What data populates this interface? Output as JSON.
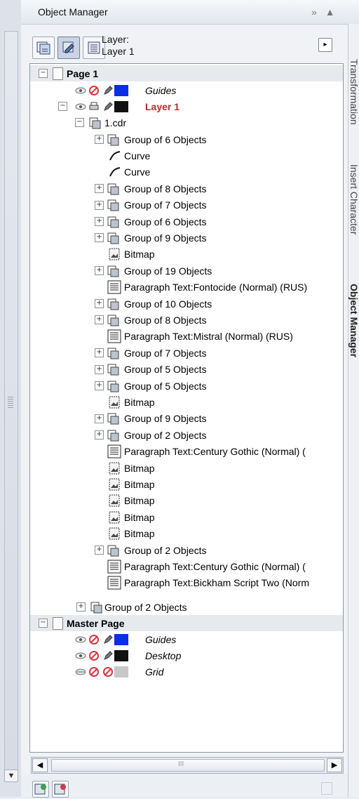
{
  "window": {
    "title": "Object Manager",
    "collapse_glyph": "»",
    "scroll_up_glyph": "▲"
  },
  "toolbar": {
    "layer_caption_line1": "Layer:",
    "layer_caption_line2": "Layer 1",
    "menu_glyph": "▸",
    "buttons": [
      "show-object-properties-icon",
      "edit-across-layers-icon",
      "layer-manager-view-icon"
    ]
  },
  "tree": {
    "page1": {
      "label": "Page 1",
      "guides": "Guides",
      "layer1": "Layer 1",
      "layer1_color": "#c1272d",
      "doc": "1.cdr"
    },
    "objects": [
      {
        "type": "group",
        "label": "Group of 6 Objects"
      },
      {
        "type": "curve",
        "label": "Curve"
      },
      {
        "type": "curve",
        "label": "Curve"
      },
      {
        "type": "group",
        "label": "Group of 8 Objects"
      },
      {
        "type": "group",
        "label": "Group of 7 Objects"
      },
      {
        "type": "group",
        "label": "Group of 6 Objects"
      },
      {
        "type": "group",
        "label": "Group of 9 Objects"
      },
      {
        "type": "bitmap",
        "label": "Bitmap"
      },
      {
        "type": "group",
        "label": "Group of 19 Objects"
      },
      {
        "type": "para",
        "label": "Paragraph Text:Fontocide (Normal) (RUS)"
      },
      {
        "type": "group",
        "label": "Group of 10 Objects"
      },
      {
        "type": "group",
        "label": "Group of 8 Objects"
      },
      {
        "type": "para",
        "label": "Paragraph Text:Mistral (Normal) (RUS)"
      },
      {
        "type": "group",
        "label": "Group of 7 Objects"
      },
      {
        "type": "group",
        "label": "Group of 5 Objects"
      },
      {
        "type": "group",
        "label": "Group of 5 Objects"
      },
      {
        "type": "bitmap",
        "label": "Bitmap"
      },
      {
        "type": "group",
        "label": "Group of 9 Objects"
      },
      {
        "type": "group",
        "label": "Group of 2 Objects"
      },
      {
        "type": "para",
        "label": "Paragraph Text:Century Gothic (Normal) ("
      },
      {
        "type": "bitmap",
        "label": "Bitmap"
      },
      {
        "type": "bitmap",
        "label": "Bitmap"
      },
      {
        "type": "bitmap",
        "label": "Bitmap"
      },
      {
        "type": "bitmap",
        "label": "Bitmap"
      },
      {
        "type": "bitmap",
        "label": "Bitmap"
      },
      {
        "type": "group",
        "label": "Group of 2 Objects"
      },
      {
        "type": "para",
        "label": "Paragraph Text:Century Gothic (Normal) ("
      },
      {
        "type": "para",
        "label": "Paragraph Text:Bickham Script Two (Norm"
      }
    ],
    "layer_group": "Group of 2 Objects",
    "master": {
      "label": "Master Page",
      "guides": "Guides",
      "desktop": "Desktop",
      "grid": "Grid"
    }
  },
  "side_tabs": [
    "Transformation",
    "Insert Character",
    "Object Manager"
  ],
  "colors": {
    "guides_swatch": "#0a2fe6",
    "layer_swatch": "#111111",
    "grid_swatch": "#c8c8c8",
    "accent_red": "#c1272d"
  },
  "scroll": {
    "left_glyph": "◀",
    "right_glyph": "▶",
    "thumb_grip": "III"
  },
  "gutter": {
    "up_glyph": "▲",
    "down_glyph": "▼"
  }
}
